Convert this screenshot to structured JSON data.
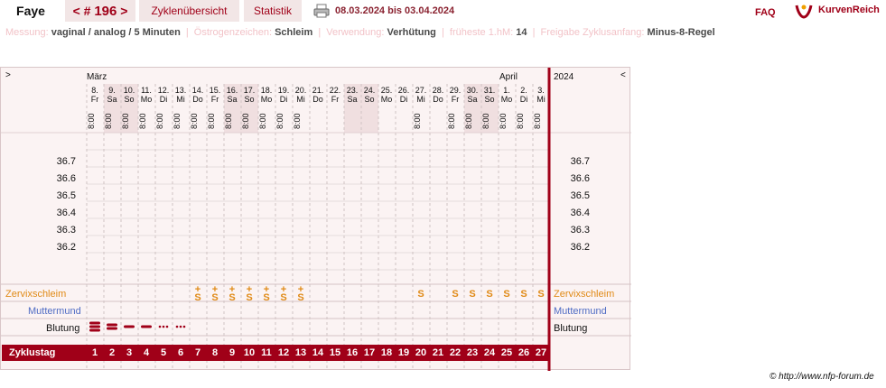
{
  "header": {
    "user": "Faye",
    "cycle_prev": "<",
    "cycle_label": "#",
    "cycle_number": "196",
    "cycle_next": ">",
    "tab_overview": "Zyklenübersicht",
    "tab_statistics": "Statistik",
    "date_range": "08.03.2024 bis 03.04.2024",
    "faq": "FAQ",
    "logo_text": "KurvenReich"
  },
  "settings": {
    "measure_label": "Messung:",
    "measure_value": "vaginal / analog / 5 Minuten",
    "estrogen_label": "Östrogenzeichen:",
    "estrogen_value": "Schleim",
    "usage_label": "Verwendung:",
    "usage_value": "Verhütung",
    "earliest_label": "früheste 1.hM:",
    "earliest_value": "14",
    "release_label": "Freigabe Zyklusanfang:",
    "release_value": "Minus-8-Regel"
  },
  "chart": {
    "nav_left": ">",
    "nav_right": "<",
    "month_1": "März",
    "month_2": "April",
    "year": "2024",
    "time": "8:00",
    "days": [
      {
        "d": "8.",
        "w": "Fr",
        "we": false,
        "t": true
      },
      {
        "d": "9.",
        "w": "Sa",
        "we": true,
        "t": true
      },
      {
        "d": "10.",
        "w": "So",
        "we": true,
        "t": true
      },
      {
        "d": "11.",
        "w": "Mo",
        "we": false,
        "t": true
      },
      {
        "d": "12.",
        "w": "Di",
        "we": false,
        "t": true
      },
      {
        "d": "13.",
        "w": "Mi",
        "we": false,
        "t": true
      },
      {
        "d": "14.",
        "w": "Do",
        "we": false,
        "t": true
      },
      {
        "d": "15.",
        "w": "Fr",
        "we": false,
        "t": true
      },
      {
        "d": "16.",
        "w": "Sa",
        "we": true,
        "t": true
      },
      {
        "d": "17.",
        "w": "So",
        "we": true,
        "t": true
      },
      {
        "d": "18.",
        "w": "Mo",
        "we": false,
        "t": true
      },
      {
        "d": "19.",
        "w": "Di",
        "we": false,
        "t": true
      },
      {
        "d": "20.",
        "w": "Mi",
        "we": false,
        "t": true
      },
      {
        "d": "21.",
        "w": "Do",
        "we": false,
        "t": false
      },
      {
        "d": "22.",
        "w": "Fr",
        "we": false,
        "t": false
      },
      {
        "d": "23.",
        "w": "Sa",
        "we": true,
        "t": false
      },
      {
        "d": "24.",
        "w": "So",
        "we": true,
        "t": false
      },
      {
        "d": "25.",
        "w": "Mo",
        "we": false,
        "t": false
      },
      {
        "d": "26.",
        "w": "Di",
        "we": false,
        "t": false
      },
      {
        "d": "27.",
        "w": "Mi",
        "we": false,
        "t": true
      },
      {
        "d": "28.",
        "w": "Do",
        "we": false,
        "t": false
      },
      {
        "d": "29.",
        "w": "Fr",
        "we": false,
        "t": true
      },
      {
        "d": "30.",
        "w": "Sa",
        "we": true,
        "t": true
      },
      {
        "d": "31.",
        "w": "So",
        "we": true,
        "t": true
      },
      {
        "d": "1.",
        "w": "Mo",
        "we": false,
        "t": true
      },
      {
        "d": "2.",
        "w": "Di",
        "we": false,
        "t": true
      },
      {
        "d": "3.",
        "w": "Mi",
        "we": false,
        "t": true
      }
    ],
    "temps": [
      "36.7",
      "36.6",
      "36.5",
      "36.4",
      "36.3",
      "36.2"
    ],
    "row_zervix": "Zervixschleim",
    "row_muttermund": "Muttermund",
    "row_blutung": "Blutung",
    "row_zyklustag": "Zyklustag",
    "mucus": [
      "",
      "",
      "",
      "",
      "",
      "",
      "S+",
      "S+",
      "S+",
      "S+",
      "S+",
      "S+",
      "S+",
      "",
      "",
      "",
      "",
      "",
      "",
      "S",
      "",
      "S",
      "S",
      "S",
      "S",
      "S",
      "S"
    ],
    "bleeding": [
      3,
      2,
      1,
      1,
      0.5,
      0.5,
      0,
      0,
      0,
      0,
      0,
      0,
      0,
      0,
      0,
      0,
      0,
      0,
      0,
      0,
      0,
      0,
      0,
      0,
      0,
      0,
      0
    ],
    "cycledays": [
      "1",
      "2",
      "3",
      "4",
      "5",
      "6",
      "7",
      "8",
      "9",
      "10",
      "11",
      "12",
      "13",
      "14",
      "15",
      "16",
      "17",
      "18",
      "19",
      "20",
      "21",
      "22",
      "23",
      "24",
      "25",
      "26",
      "27"
    ],
    "colors": {
      "accent": "#a00018",
      "mucus": "#e08a16",
      "cervix": "#4f6cc4",
      "weekend": "#f0dfe0"
    }
  },
  "footer": {
    "copyright": "© http://www.nfp-forum.de"
  }
}
